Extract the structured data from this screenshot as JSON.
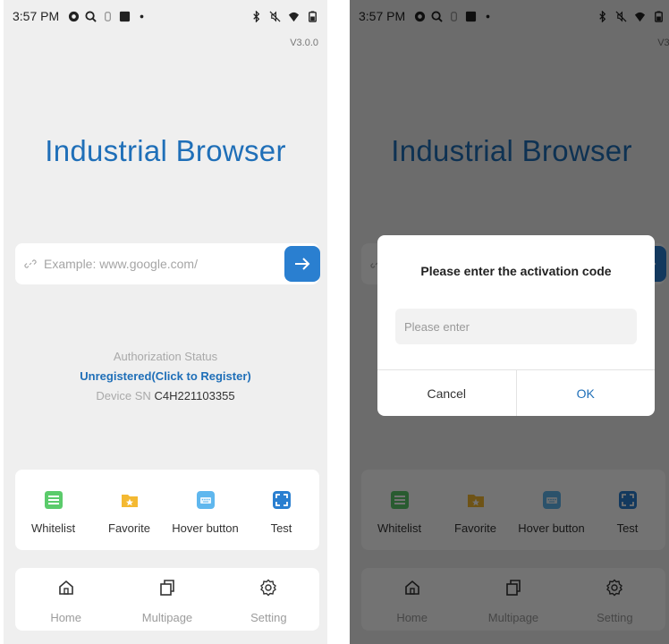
{
  "status_bar": {
    "time": "3:57 PM",
    "left_icons": [
      "app-badge-icon",
      "zoom-icon",
      "hand-icon",
      "square-icon",
      "dot-icon"
    ],
    "right_icons": [
      "bluetooth-icon",
      "mute-icon",
      "wifi-icon",
      "battery-icon"
    ]
  },
  "app": {
    "version": "V3.0.0",
    "title": "Industrial Browser",
    "url_placeholder": "Example: www.google.com/",
    "accent_color": "#1f6fb8"
  },
  "auth": {
    "status_label": "Authorization Status",
    "register_link": "Unregistered(Click to Register)",
    "sn_label": "Device SN",
    "sn_value": "C4H221103355"
  },
  "quick_actions": [
    {
      "label": "Whitelist",
      "icon": "list-icon",
      "color": "#5bcb6b"
    },
    {
      "label": "Favorite",
      "icon": "folder-star-icon",
      "color": "#f4b932"
    },
    {
      "label": "Hover button",
      "icon": "keyboard-icon",
      "color": "#5fb7ee"
    },
    {
      "label": "Test",
      "icon": "scan-icon",
      "color": "#2a7fd0"
    }
  ],
  "bottom_nav": [
    {
      "label": "Home",
      "icon": "home-icon"
    },
    {
      "label": "Multipage",
      "icon": "multipage-icon"
    },
    {
      "label": "Setting",
      "icon": "gear-icon"
    }
  ],
  "dialog": {
    "title": "Please enter the activation code",
    "input_placeholder": "Please enter",
    "cancel_label": "Cancel",
    "ok_label": "OK"
  }
}
